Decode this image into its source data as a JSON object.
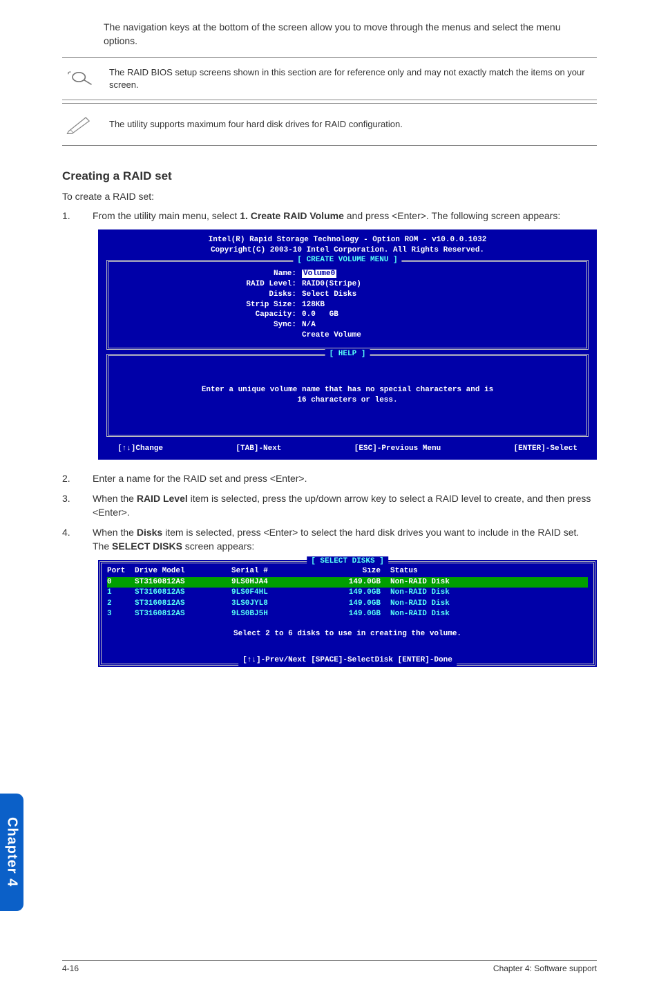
{
  "intro": "The navigation keys at the bottom of the screen allow you to move through the menus and select the menu options.",
  "notes": {
    "n1": "The RAID BIOS setup screens shown in this section are for reference only and may not exactly match the items on your screen.",
    "n2": "The utility supports maximum four hard disk drives for RAID configuration."
  },
  "section_heading": "Creating a RAID set",
  "section_intro": "To create a RAID set:",
  "steps": {
    "s1_num": "1.",
    "s1_a": "From the utility main menu, select ",
    "s1_b": "1. Create RAID Volume",
    "s1_c": " and press <Enter>. The following screen appears:",
    "s2_num": "2.",
    "s2": "Enter a name for the RAID set and press <Enter>.",
    "s3_num": "3.",
    "s3_a": "When the ",
    "s3_b": "RAID Level",
    "s3_c": " item is selected, press the up/down arrow key to select a RAID level to create, and then press <Enter>.",
    "s4_num": "4.",
    "s4_a": "When the ",
    "s4_b": "Disks",
    "s4_c": " item is selected, press <Enter> to select the hard disk drives you want to include in the RAID set. The ",
    "s4_d": "SELECT DISKS",
    "s4_e": " screen appears:"
  },
  "bios": {
    "header1": "Intel(R) Rapid Storage Technology - Option ROM - v10.0.0.1032",
    "header2": "Copyright(C) 2003-10 Intel Corporation.  All Rights Reserved.",
    "create_title": "[ CREATE VOLUME MENU ]",
    "labels": {
      "name": "Name:",
      "raid_level": "RAID Level:",
      "disks": "Disks:",
      "strip_size": "Strip Size:",
      "capacity": "Capacity:",
      "sync": "Sync:"
    },
    "values": {
      "name": "Volume0",
      "raid_level": "RAID0(Stripe)",
      "disks": "Select Disks",
      "strip_size": "128KB",
      "capacity": "0.0   GB",
      "sync": "N/A",
      "create": "Create Volume"
    },
    "help_title": "[ HELP ]",
    "help_text1": "Enter a unique volume name that has no special characters and is",
    "help_text2": "16 characters or less.",
    "footer": {
      "f1": "[↑↓]Change",
      "f2": "[TAB]-Next",
      "f3": "[ESC]-Previous Menu",
      "f4": "[ENTER]-Select"
    }
  },
  "select_disks": {
    "title": "[ SELECT DISKS ]",
    "head": {
      "c1": "Port",
      "c2": "Drive Model",
      "c3": "Serial #",
      "c4": "Size",
      "c5": "Status"
    },
    "rows": [
      {
        "sel": true,
        "c1": "0",
        "c2": "ST3160812AS",
        "c3": "9LS0HJA4",
        "c4": "149.0GB",
        "c5": "Non-RAID Disk"
      },
      {
        "sel": false,
        "c1": "1",
        "c2": "ST3160812AS",
        "c3": "9LS0F4HL",
        "c4": "149.0GB",
        "c5": "Non-RAID Disk"
      },
      {
        "sel": false,
        "c1": "2",
        "c2": "ST3160812AS",
        "c3": "3LS0JYL8",
        "c4": "149.0GB",
        "c5": "Non-RAID Disk"
      },
      {
        "sel": false,
        "c1": "3",
        "c2": "ST3160812AS",
        "c3": "9LS0BJ5H",
        "c4": "149.0GB",
        "c5": "Non-RAID Disk"
      }
    ],
    "help": "Select 2 to 6 disks to use in creating the volume.",
    "footer": "[↑↓]-Prev/Next [SPACE]-SelectDisk [ENTER]-Done"
  },
  "side_tab": "Chapter 4",
  "page_footer": {
    "left": "4-16",
    "right": "Chapter 4: Software support"
  }
}
